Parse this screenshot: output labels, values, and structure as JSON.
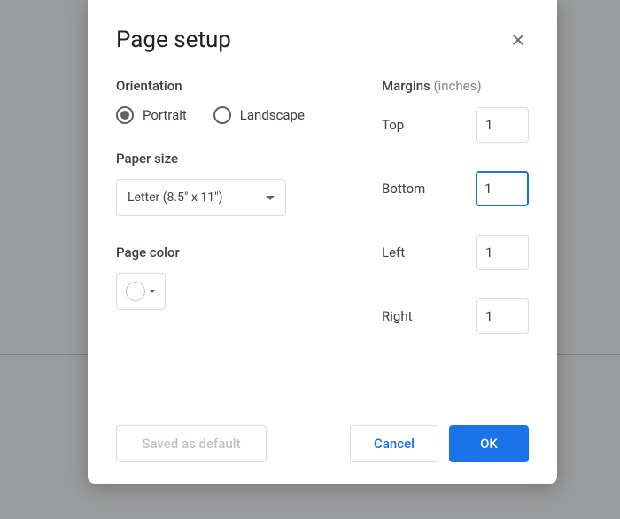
{
  "dialog": {
    "title": "Page setup",
    "orientation": {
      "label": "Orientation",
      "options": {
        "portrait": "Portrait",
        "landscape": "Landscape"
      },
      "selected": "portrait"
    },
    "paper_size": {
      "label": "Paper size",
      "value": "Letter (8.5\" x 11\")"
    },
    "page_color": {
      "label": "Page color",
      "value": "#ffffff"
    },
    "margins": {
      "label": "Margins",
      "unit_hint": "(inches)",
      "top": {
        "label": "Top",
        "value": "1"
      },
      "bottom": {
        "label": "Bottom",
        "value": "1"
      },
      "left": {
        "label": "Left",
        "value": "1"
      },
      "right": {
        "label": "Right",
        "value": "1"
      },
      "focused": "bottom"
    },
    "buttons": {
      "default": "Saved as default",
      "cancel": "Cancel",
      "ok": "OK"
    }
  }
}
